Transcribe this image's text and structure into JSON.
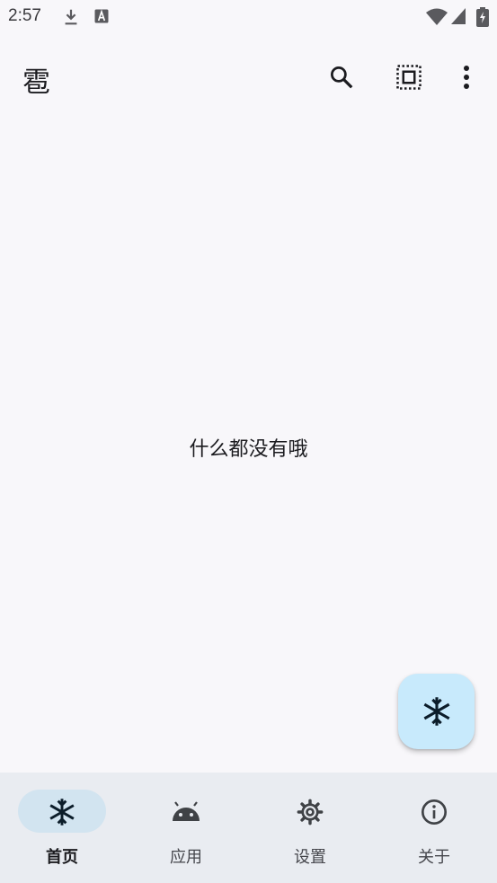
{
  "status_bar": {
    "time": "2:57",
    "icons": [
      "download-icon",
      "a-box-icon",
      "wifi-icon",
      "signal-icon",
      "battery-charging-icon"
    ]
  },
  "app_bar": {
    "title": "雹",
    "actions": [
      "search-icon",
      "select-all-icon",
      "more-vert-icon"
    ]
  },
  "main": {
    "empty_message": "什么都没有哦"
  },
  "fab": {
    "icon": "snowflake-icon",
    "color": "#c8eafc"
  },
  "bottom_nav": {
    "active_index": 0,
    "items": [
      {
        "label": "首页",
        "icon": "snowflake-icon"
      },
      {
        "label": "应用",
        "icon": "android-icon"
      },
      {
        "label": "设置",
        "icon": "gear-icon"
      },
      {
        "label": "关于",
        "icon": "info-icon"
      }
    ]
  },
  "colors": {
    "background": "#f8f7fa",
    "nav_background": "#e9ecf1",
    "active_indicator": "#d2e4f0",
    "text": "#1b1b1f"
  }
}
